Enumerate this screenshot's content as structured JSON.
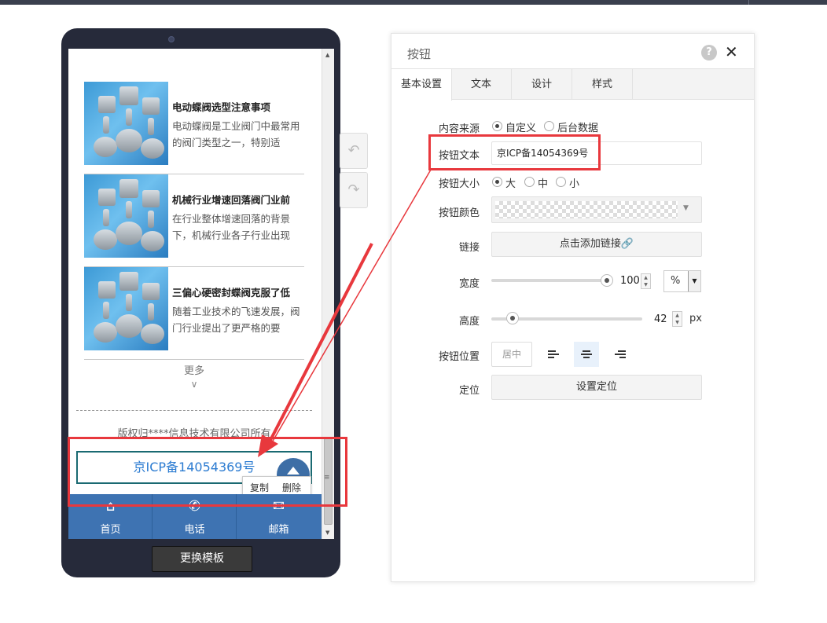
{
  "phone": {
    "news": [
      {
        "title": "电动蝶阀选型注意事项",
        "desc": "电动蝶阀是工业阀门中最常用的阀门类型之一，特别适"
      },
      {
        "title": "机械行业增速回落阀门业前",
        "desc": "在行业整体增速回落的背景下，机械行业各子行业出现"
      },
      {
        "title": "三偏心硬密封蝶阀克服了低",
        "desc": "随着工业技术的飞速发展，阀门行业提出了更严格的要"
      }
    ],
    "more_label": "更多",
    "more_chevron": "∨",
    "copyright": "版权归****信息技术有限公司所有",
    "icp_button": "京ICP备14054369号",
    "context_menu": {
      "copy": "复制",
      "delete": "删除"
    },
    "bottom_nav": [
      {
        "label": "首页",
        "icon": "home-icon",
        "glyph": "⌂"
      },
      {
        "label": "电话",
        "icon": "phone-icon",
        "glyph": "✆"
      },
      {
        "label": "邮箱",
        "icon": "mail-icon",
        "glyph": "✉"
      }
    ],
    "switch_template": "更换模板"
  },
  "toolbar": {
    "undo_glyph": "↶",
    "redo_glyph": "↷"
  },
  "panel": {
    "title": "按钮",
    "help": "?",
    "close": "✕",
    "tabs": [
      "基本设置",
      "文本",
      "设计",
      "样式"
    ],
    "content_source": {
      "label": "内容来源",
      "options": [
        "自定义",
        "后台数据"
      ],
      "selected": "自定义"
    },
    "button_text": {
      "label": "按钮文本",
      "value": "京ICP备14054369号"
    },
    "button_size": {
      "label": "按钮大小",
      "options": [
        "大",
        "中",
        "小"
      ],
      "selected": "大"
    },
    "button_color": {
      "label": "按钮颜色",
      "caret": "▼"
    },
    "link": {
      "label": "链接",
      "button": "点击添加链接🔗"
    },
    "width": {
      "label": "宽度",
      "value": "100",
      "unit": "%",
      "unit_caret": "▼"
    },
    "height": {
      "label": "高度",
      "value": "42",
      "unit": "px"
    },
    "position": {
      "label": "按钮位置",
      "center": "居中",
      "selected_align": "center"
    },
    "positioning": {
      "label": "定位",
      "button": "设置定位"
    }
  },
  "colors": {
    "accent": "#3e73b2",
    "highlight": "#e8383d",
    "icp_text": "#2b7bd1"
  }
}
